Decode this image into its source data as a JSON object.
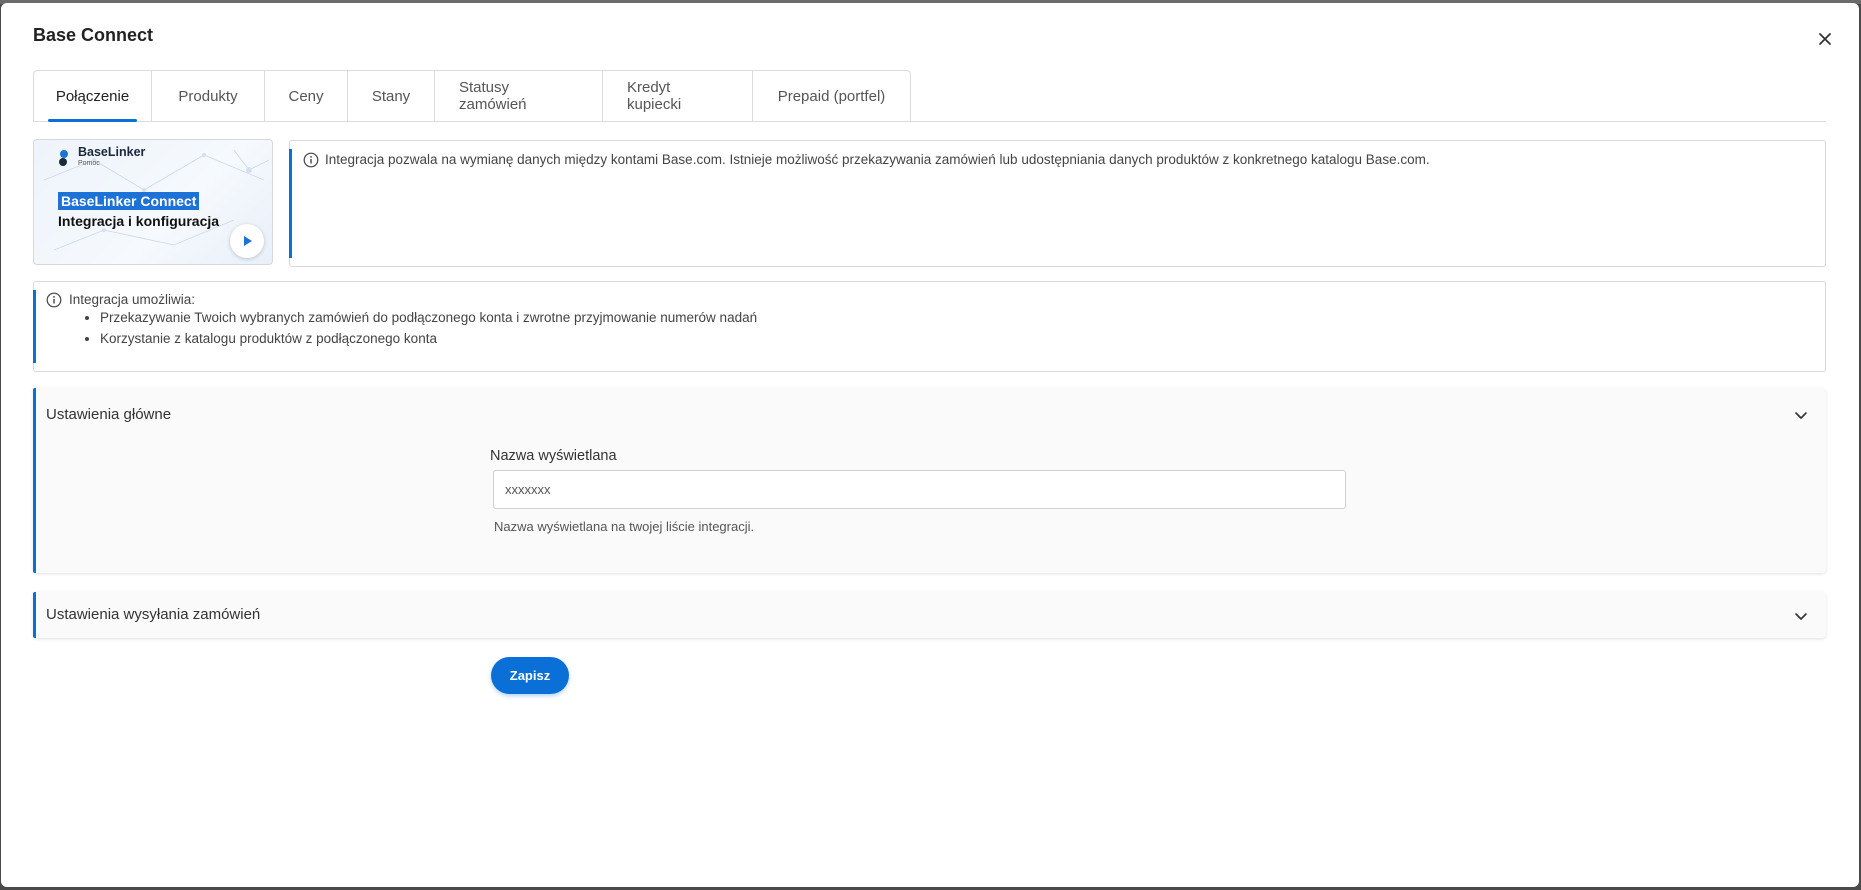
{
  "modal": {
    "title": "Base Connect"
  },
  "tabs": [
    {
      "label": "Połączenie",
      "active": true
    },
    {
      "label": "Produkty",
      "active": false
    },
    {
      "label": "Ceny",
      "active": false
    },
    {
      "label": "Stany",
      "active": false
    },
    {
      "label": "Statusy zamówień",
      "active": false
    },
    {
      "label": "Kredyt kupiecki",
      "active": false
    },
    {
      "label": "Prepaid (portfel)",
      "active": false
    }
  ],
  "video": {
    "logo_name": "BaseLinker",
    "logo_sub": "Pomoc",
    "title_line1": "BaseLinker Connect",
    "title_line2": "Integracja i konfiguracja"
  },
  "info_main": {
    "text": "Integracja pozwala na wymianę danych między kontami Base.com. Istnieje możliwość przekazywania zamówień lub udostępniania danych produktów z konkretnego katalogu Base.com."
  },
  "info_features": {
    "heading": "Integracja umożliwia:",
    "items": [
      "Przekazywanie Twoich wybranych zamówień do podłączonego konta i zwrotne przyjmowanie numerów nadań",
      "Korzystanie z katalogu produktów z podłączonego konta"
    ]
  },
  "section_main": {
    "title": "Ustawienia główne",
    "field_label": "Nazwa wyświetlana",
    "field_value": "xxxxxxx",
    "field_help": "Nazwa wyświetlana na twojej liście integracji."
  },
  "section_orders": {
    "title": "Ustawienia wysyłania zamówień"
  },
  "save_label": "Zapisz",
  "colors": {
    "accent": "#0a6fd6"
  }
}
